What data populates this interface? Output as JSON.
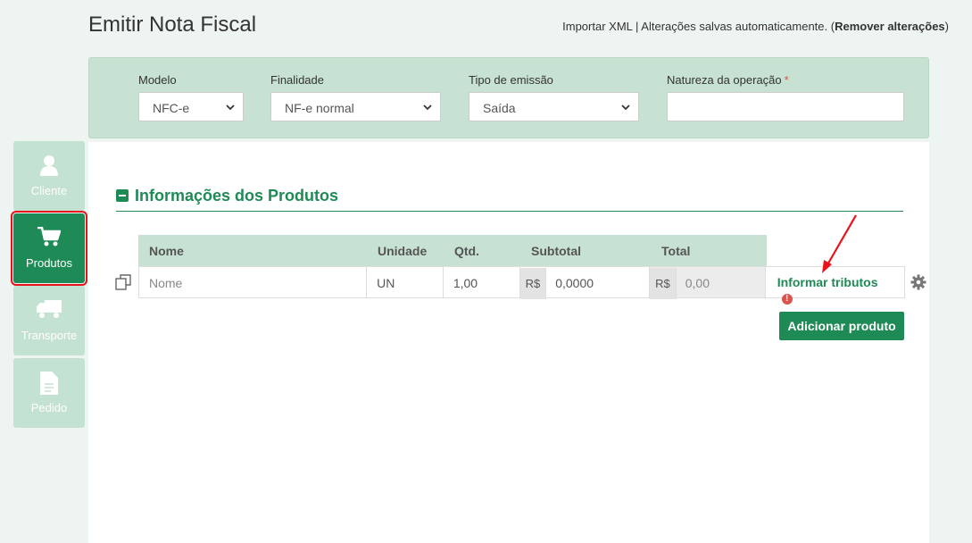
{
  "page": {
    "title": "Emitir Nota Fiscal",
    "import_xml": "Importar XML",
    "separator": " | ",
    "autosave_text": "Alterações salvas automaticamente. (",
    "remove_changes": "Remover alterações",
    "close_paren": ")"
  },
  "header": {
    "modelo": {
      "label": "Modelo",
      "value": "NFC-e"
    },
    "finalidade": {
      "label": "Finalidade",
      "value": "NF-e normal"
    },
    "tipo_emissao": {
      "label": "Tipo de emissão",
      "value": "Saída"
    },
    "natureza": {
      "label": "Natureza da operação",
      "required_mark": "*",
      "value": ""
    }
  },
  "sidebar": {
    "items": [
      {
        "label": "Cliente",
        "icon": "user-icon",
        "active": false
      },
      {
        "label": "Produtos",
        "icon": "cart-icon",
        "active": true
      },
      {
        "label": "Transporte",
        "icon": "truck-icon",
        "active": false
      },
      {
        "label": "Pedido",
        "icon": "document-icon",
        "active": false
      }
    ]
  },
  "products": {
    "section_title": "Informações dos Produtos",
    "columns": [
      "Nome",
      "Unidade",
      "Qtd.",
      "Subtotal",
      "Total"
    ],
    "row": {
      "nome_placeholder": "Nome",
      "unidade": "UN",
      "qtd": "1,00",
      "currency": "R$",
      "subtotal": "0,0000",
      "total": "0,00"
    },
    "informar_tributos": "Informar tributos",
    "alert_glyph": "!",
    "add_button": "Adicionar produto"
  },
  "colors": {
    "accent": "#1e8a55",
    "panel": "#c7e2d3",
    "annotation": "#e8131a"
  }
}
